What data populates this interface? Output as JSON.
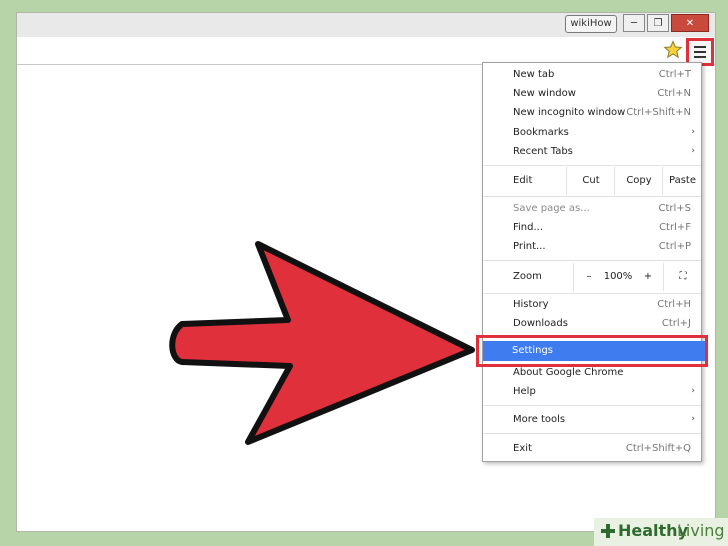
{
  "titlebar": {
    "user_button": "wikiHow",
    "minimize": "─",
    "restore": "❐",
    "close": "✕"
  },
  "toolbar": {
    "bookmark_icon": "star-icon",
    "menu_icon": "hamburger-menu-icon"
  },
  "menu": {
    "new_tab": {
      "label": "New tab",
      "shortcut": "Ctrl+T"
    },
    "new_window": {
      "label": "New window",
      "shortcut": "Ctrl+N"
    },
    "new_incognito": {
      "label": "New incognito window",
      "shortcut": "Ctrl+Shift+N"
    },
    "bookmarks": {
      "label": "Bookmarks",
      "arrow": "›"
    },
    "recent_tabs": {
      "label": "Recent Tabs",
      "arrow": "›"
    },
    "edit": {
      "label": "Edit",
      "cut": "Cut",
      "copy": "Copy",
      "paste": "Paste"
    },
    "save_page": {
      "label": "Save page as...",
      "shortcut": "Ctrl+S"
    },
    "find": {
      "label": "Find...",
      "shortcut": "Ctrl+F"
    },
    "print": {
      "label": "Print...",
      "shortcut": "Ctrl+P"
    },
    "zoom": {
      "label": "Zoom",
      "minus": "–",
      "level": "100%",
      "plus": "+",
      "fullscreen": "⛶"
    },
    "history": {
      "label": "History",
      "shortcut": "Ctrl+H"
    },
    "downloads": {
      "label": "Downloads",
      "shortcut": "Ctrl+J"
    },
    "settings": {
      "label": "Settings"
    },
    "about": {
      "label": "About Google Chrome"
    },
    "help": {
      "label": "Help",
      "arrow": "›"
    },
    "more_tools": {
      "label": "More tools",
      "arrow": "›"
    },
    "exit": {
      "label": "Exit",
      "shortcut": "Ctrl+Shift+Q"
    }
  },
  "annotation": {
    "arrow_color": "#e0303c",
    "highlight_color": "#e0303c"
  },
  "watermark": {
    "word1": "Healthy",
    "word2": "Living"
  }
}
